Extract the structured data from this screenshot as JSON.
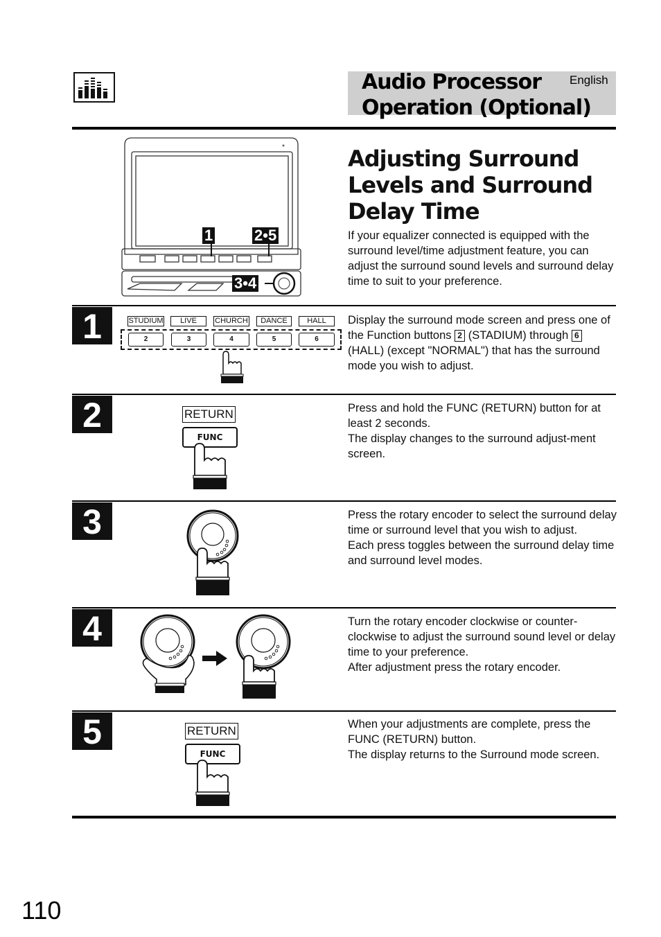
{
  "header": {
    "icon": "equalizer-icon",
    "title_line1": "Audio Processor",
    "title_line2": "Operation (Optional)",
    "language": "English"
  },
  "intro": {
    "heading_line1": "Adjusting Surround",
    "heading_line2": "Levels and Surround",
    "heading_line3": "Delay Time",
    "text": "If your equalizer connected is equipped with the surround level/time adjustment feature, you can adjust the surround sound levels and surround delay time to suit to your preference."
  },
  "device_callouts": {
    "callout_1": "1",
    "callout_2_5": "2•5",
    "callout_3_4": "3•4"
  },
  "steps": [
    {
      "number": "1",
      "modes": [
        "STUDIUM",
        "LIVE",
        "CHURCH",
        "DANCE",
        "HALL"
      ],
      "buttons": [
        "2",
        "3",
        "4",
        "5",
        "6"
      ],
      "text_a": "Display the surround mode screen and press one of the Function buttons",
      "ref_a": "2",
      "text_b": "(STADIUM) through",
      "ref_b": "6",
      "text_c": "(HALL) (except \"NORMAL\") that has the surround mode you wish to adjust."
    },
    {
      "number": "2",
      "return_label": "RETURN",
      "func_label": "FUNC",
      "text": "Press and hold the FUNC (RETURN) button for at least 2 seconds.\nThe display changes to the surround adjust-ment screen."
    },
    {
      "number": "3",
      "text": "Press the rotary encoder to select the surround delay time or surround level that you wish to adjust.\nEach press toggles between the surround delay time and surround level modes."
    },
    {
      "number": "4",
      "text": "Turn the rotary encoder clockwise or counter-clockwise to adjust the surround sound level or delay time to your preference.\nAfter adjustment press the rotary encoder."
    },
    {
      "number": "5",
      "return_label": "RETURN",
      "func_label": "FUNC",
      "text": "When your adjustments are complete, press the FUNC (RETURN) button.\nThe display returns to the Surround mode screen."
    }
  ],
  "footer": {
    "page_number": "110"
  }
}
